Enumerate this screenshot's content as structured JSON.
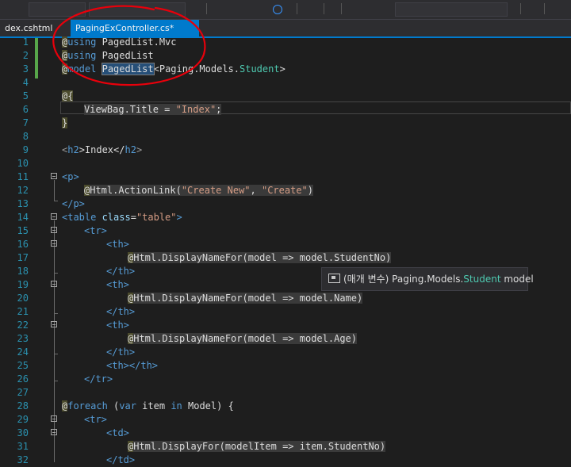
{
  "tabs": [
    {
      "label": "dex.cshtml",
      "active": false
    },
    {
      "label": "PagingExController.cs*",
      "active": true
    }
  ],
  "editor": {
    "lines": [
      {
        "n": "1"
      },
      {
        "n": "2"
      },
      {
        "n": "3"
      },
      {
        "n": "4"
      },
      {
        "n": "5"
      },
      {
        "n": "6"
      },
      {
        "n": "7"
      },
      {
        "n": "8"
      },
      {
        "n": "9"
      },
      {
        "n": "10"
      },
      {
        "n": "11"
      },
      {
        "n": "12"
      },
      {
        "n": "13"
      },
      {
        "n": "14"
      },
      {
        "n": "15"
      },
      {
        "n": "16"
      },
      {
        "n": "17"
      },
      {
        "n": "18"
      },
      {
        "n": "19"
      },
      {
        "n": "20"
      },
      {
        "n": "21"
      },
      {
        "n": "22"
      },
      {
        "n": "23"
      },
      {
        "n": "24"
      },
      {
        "n": "25"
      },
      {
        "n": "26"
      },
      {
        "n": "27"
      },
      {
        "n": "28"
      },
      {
        "n": "29"
      },
      {
        "n": "30"
      },
      {
        "n": "31"
      },
      {
        "n": "32"
      }
    ],
    "text": {
      "at": "@",
      "brace_open": "{",
      "brace_close": "}",
      "using": "using",
      "model": "model",
      "foreach": "foreach",
      "l1": " PagedList.Mvc",
      "l2": " PagedList",
      "l3_ns": "PagedList",
      "l3_rest_a": "<Paging.Models.",
      "l3_type": "Student",
      "l3_rest_b": ">",
      "l6_a": "ViewBag.Title = ",
      "l6_str": "\"Index\"",
      "l6_b": ";",
      "l9_a": "<",
      "l9_tag": "h2",
      "l9_b": ">Index</",
      "l9_c": ">",
      "l11": "<p>",
      "l12_a": "Html.ActionLink(",
      "l12_s1": "\"Create New\"",
      "l12_b": ", ",
      "l12_s2": "\"Create\"",
      "l12_c": ")",
      "l13": "</p>",
      "l14_a": "<table ",
      "l14_attr": "class",
      "l14_eq": "=",
      "l14_val": "\"table\"",
      "l14_b": ">",
      "tr_open": "<tr>",
      "tr_close": "</tr>",
      "th_open": "<th>",
      "th_close": "</th>",
      "th_empty": "<th></th>",
      "td_open": "<td>",
      "td_close": "</td>",
      "dn_a": "Html.DisplayNameFor(model => model.",
      "dn_close": ")",
      "f_studentno": "StudentNo",
      "f_name": "Name",
      "f_age": "Age",
      "l28_a": " (",
      "l28_var": "var",
      "l28_b": " item ",
      "l28_in": "in",
      "l28_c": " Model) {",
      "l31_a": "Html.DisplayFor(modelItem => item.",
      "l31_f": "StudentNo",
      "l31_b": ")"
    }
  },
  "tooltip": {
    "prefix": "(매개 변수) Paging.Models.",
    "type": "Student",
    "suffix": " model"
  },
  "colors": {
    "accent": "#007acc",
    "annotation": "#e8000b",
    "line_number": "#2b91af",
    "type": "#4ec9b0"
  }
}
